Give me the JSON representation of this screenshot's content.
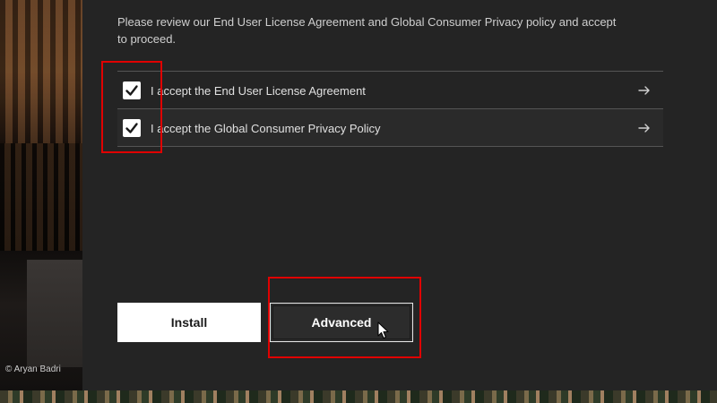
{
  "background": {
    "credit": "© Aryan Badri"
  },
  "intro_text": "Please review our End User License Agreement and Global Consumer Privacy policy and accept to proceed.",
  "agreements": [
    {
      "label": "I accept the End User License Agreement",
      "checked": true,
      "icon": "arrow-right-icon"
    },
    {
      "label": "I accept the Global Consumer Privacy Policy",
      "checked": true,
      "icon": "arrow-right-icon"
    }
  ],
  "buttons": {
    "install": "Install",
    "advanced": "Advanced"
  },
  "colors": {
    "panel": "#242424",
    "highlight": "#e00000",
    "install_bg": "#ffffff",
    "advanced_bg": "#2c2c2c"
  }
}
